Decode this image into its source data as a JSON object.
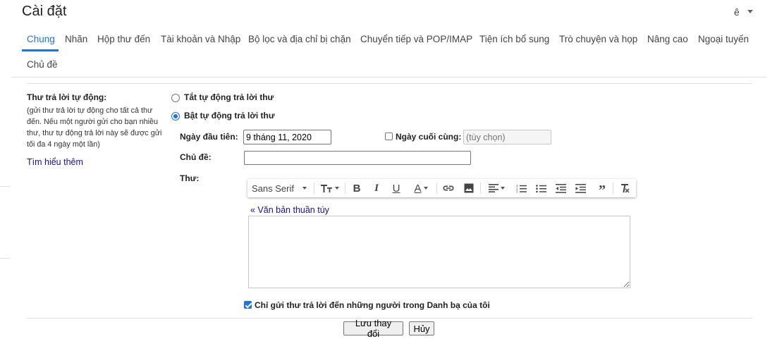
{
  "header": {
    "title": "Cài đặt",
    "language": "ê"
  },
  "tabs": [
    {
      "label": "Chung",
      "active": true
    },
    {
      "label": "Nhãn"
    },
    {
      "label": "Hộp thư đến"
    },
    {
      "label": "Tài khoản và Nhập"
    },
    {
      "label": "Bộ lọc và địa chỉ bị chặn"
    },
    {
      "label": "Chuyển tiếp và POP/IMAP"
    },
    {
      "label": "Tiện ích bổ sung"
    },
    {
      "label": "Trò chuyện và họp"
    },
    {
      "label": "Nâng cao"
    },
    {
      "label": "Ngoại tuyến"
    },
    {
      "label": "Chủ đề"
    }
  ],
  "vacation": {
    "title": "Thư trả lời tự động:",
    "description": "(gửi thư trả lời tự động cho tất cả thư đến. Nếu một người gửi cho bạn nhiều thư, thư tự động trả lời này sẽ được gửi tối đa 4 ngày một lần)",
    "learn_more": "Tìm hiểu thêm",
    "off_label": "Tắt tự động trả lời thư",
    "on_label": "Bật tự động trả lời thư",
    "selected": "on",
    "first_day_label": "Ngày đầu tiên:",
    "first_day_value": "9 tháng 11, 2020",
    "last_day_label": "Ngày cuối cùng:",
    "last_day_checked": false,
    "last_day_placeholder": "(tùy chọn)",
    "subject_label": "Chủ đề:",
    "subject_value": "",
    "message_label": "Thư:",
    "plain_text_link": "« Văn bản thuần túy",
    "contacts_only_label": "Chỉ gửi thư trả lời đến những người trong Danh bạ của tôi",
    "contacts_only_checked": true
  },
  "toolbar": {
    "font": "Sans Serif",
    "icons": [
      "font-size-icon",
      "bold-icon",
      "italic-icon",
      "underline-icon",
      "text-color-icon",
      "link-icon",
      "image-icon",
      "align-icon",
      "numbered-list-icon",
      "bulleted-list-icon",
      "indent-less-icon",
      "indent-more-icon",
      "quote-icon",
      "remove-formatting-icon"
    ]
  },
  "actions": {
    "save": "Lưu thay đổi",
    "cancel": "Hủy"
  },
  "colors": {
    "accent": "#1a73e8",
    "link": "#1a0dab"
  }
}
